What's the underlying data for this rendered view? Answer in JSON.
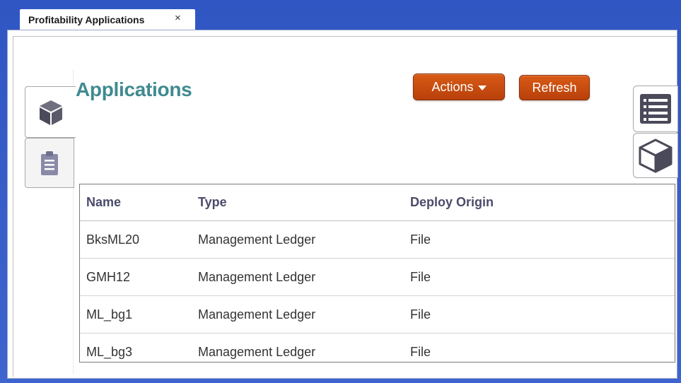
{
  "tab": {
    "label": "Profitability Applications",
    "close": "×"
  },
  "page": {
    "title": "Applications"
  },
  "toolbar": {
    "actions_label": "Actions",
    "refresh_label": "Refresh"
  },
  "colors": {
    "title": "#3f8a8f",
    "button": "#c84e10",
    "tab_strip": "#3558c8"
  },
  "left_tabs": [
    {
      "icon": "cube-icon",
      "selected": true
    },
    {
      "icon": "clipboard-icon",
      "selected": false
    }
  ],
  "right_tabs": [
    {
      "icon": "list-icon"
    },
    {
      "icon": "cube-outline-icon"
    }
  ],
  "table": {
    "columns": [
      "Name",
      "Type",
      "Deploy Origin"
    ],
    "rows": [
      {
        "name": "BksML20",
        "type": "Management Ledger",
        "origin": "File"
      },
      {
        "name": "GMH12",
        "type": "Management Ledger",
        "origin": "File"
      },
      {
        "name": "ML_bg1",
        "type": "Management Ledger",
        "origin": "File"
      },
      {
        "name": "ML_bg3",
        "type": "Management Ledger",
        "origin": "File"
      }
    ]
  }
}
